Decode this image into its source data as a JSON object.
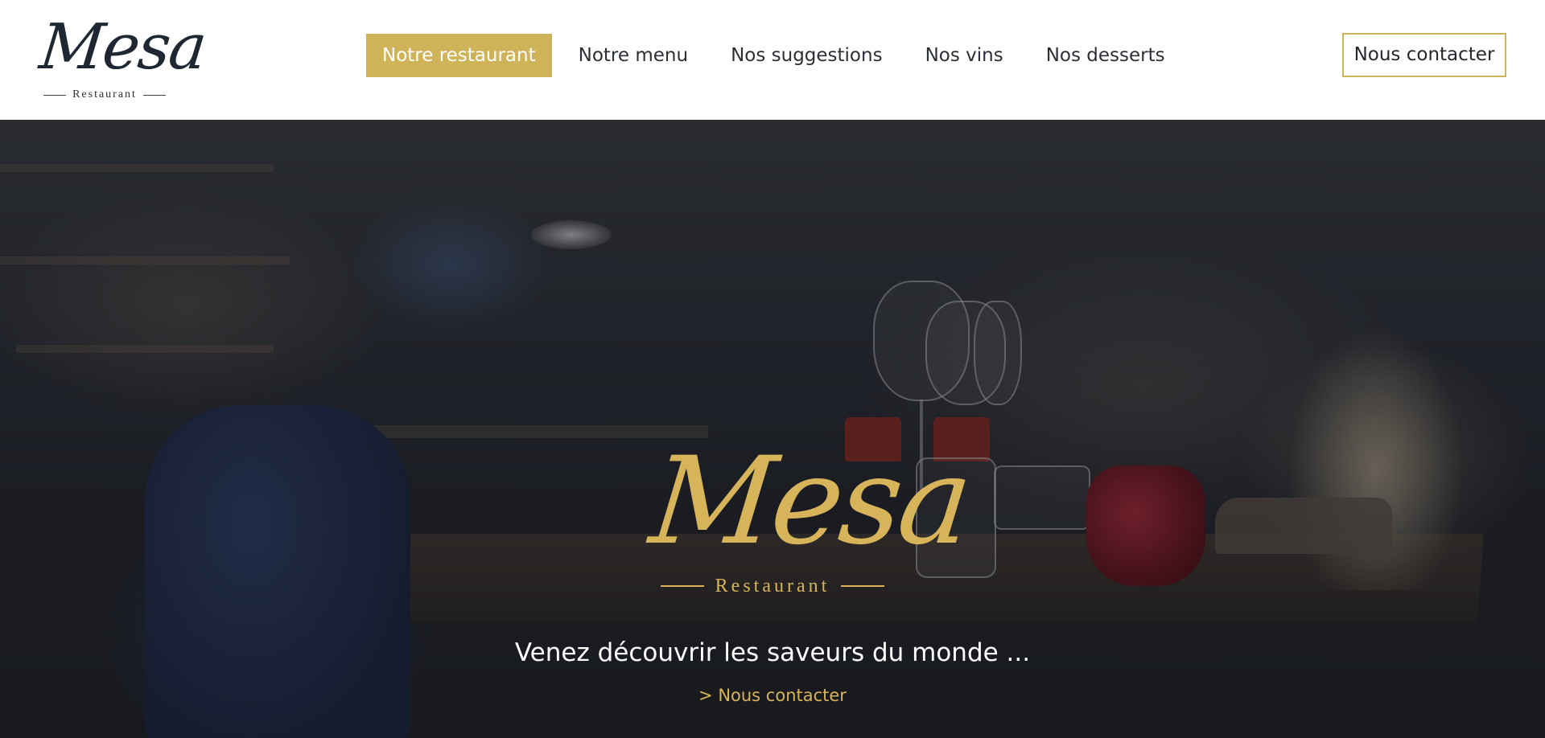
{
  "brand": {
    "logo_text": "Mesa",
    "logo_subtitle": "Restaurant"
  },
  "nav": {
    "items": [
      {
        "label": "Notre restaurant",
        "active": true
      },
      {
        "label": "Notre menu",
        "active": false
      },
      {
        "label": "Nos suggestions",
        "active": false
      },
      {
        "label": "Nos vins",
        "active": false
      },
      {
        "label": "Nos desserts",
        "active": false
      }
    ],
    "contact_button": "Nous contacter"
  },
  "hero": {
    "logo_text": "Mesa",
    "logo_subtitle": "Restaurant",
    "tagline": "Venez découvrir les saveurs du monde ...",
    "link": "> Nous contacter"
  },
  "colors": {
    "accent_gold": "#cfb358",
    "hero_gold": "#d7b45a",
    "text_dark": "#2b2f36",
    "header_bg": "#ffffff"
  }
}
